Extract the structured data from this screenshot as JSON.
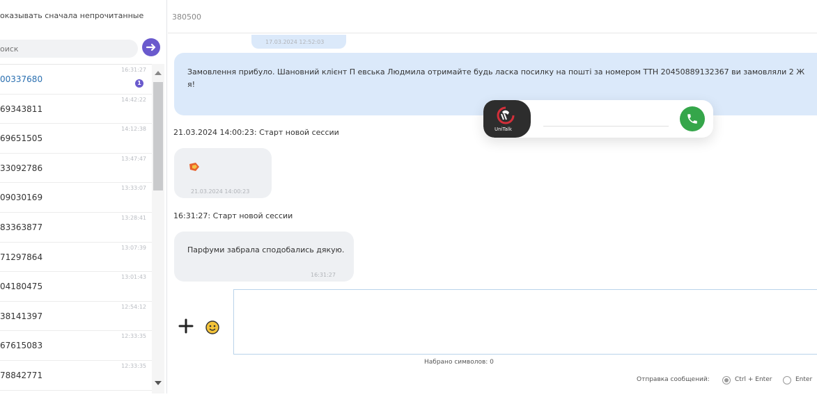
{
  "sidebar": {
    "filter_label": "оказывать сначала непрочитанные",
    "search_placeholder": "оиск",
    "items": [
      {
        "number": "00337680",
        "time": "16:31:27",
        "badge": "1"
      },
      {
        "number": "69343811",
        "time": "14:42:22"
      },
      {
        "number": "69651505",
        "time": "14:12:38"
      },
      {
        "number": "33092786",
        "time": "13:47:47"
      },
      {
        "number": "09030169",
        "time": "13:33:07"
      },
      {
        "number": "83363877",
        "time": "13:28:41"
      },
      {
        "number": "71297864",
        "time": "13:07:39"
      },
      {
        "number": "04180475",
        "time": "13:01:43"
      },
      {
        "number": "38141397",
        "time": "12:54:12"
      },
      {
        "number": "67615083",
        "time": "12:33:35"
      },
      {
        "number": "78842771",
        "time": "12:33:35"
      }
    ]
  },
  "header": {
    "phone": "380500"
  },
  "messages": {
    "first_time": "17.03.2024 12:52:03",
    "first_text": "Замовлення прибуло. Шановний клієнт П       евська Людмила отримайте будь ласка посилку на пошті за номером ТТН 20450889132367 ви замовляли 2 Ж",
    "first_text_cont": "я!",
    "session1": "21.03.2024 14:00:23: Старт новой сессии",
    "sticker_time": "21.03.2024 14:00:23",
    "session2": "16:31:27: Старт новой сессии",
    "last_text": "Парфуми забрала сподобались дякую.",
    "last_time": "16:31:27"
  },
  "call_widget": {
    "logo_text": "UniTalk"
  },
  "composer": {
    "char_count": "Набрано символов: 0",
    "send_label": "Отправка сообщений:",
    "option_ctrl": "Ctrl + Enter",
    "option_enter": "Enter"
  },
  "colors": {
    "accent": "#6a5acd",
    "call_green": "#35a64a",
    "outgoing_bubble": "#dbe9fa",
    "incoming_bubble": "#eef0f3",
    "active_number": "#2a6fb0"
  }
}
